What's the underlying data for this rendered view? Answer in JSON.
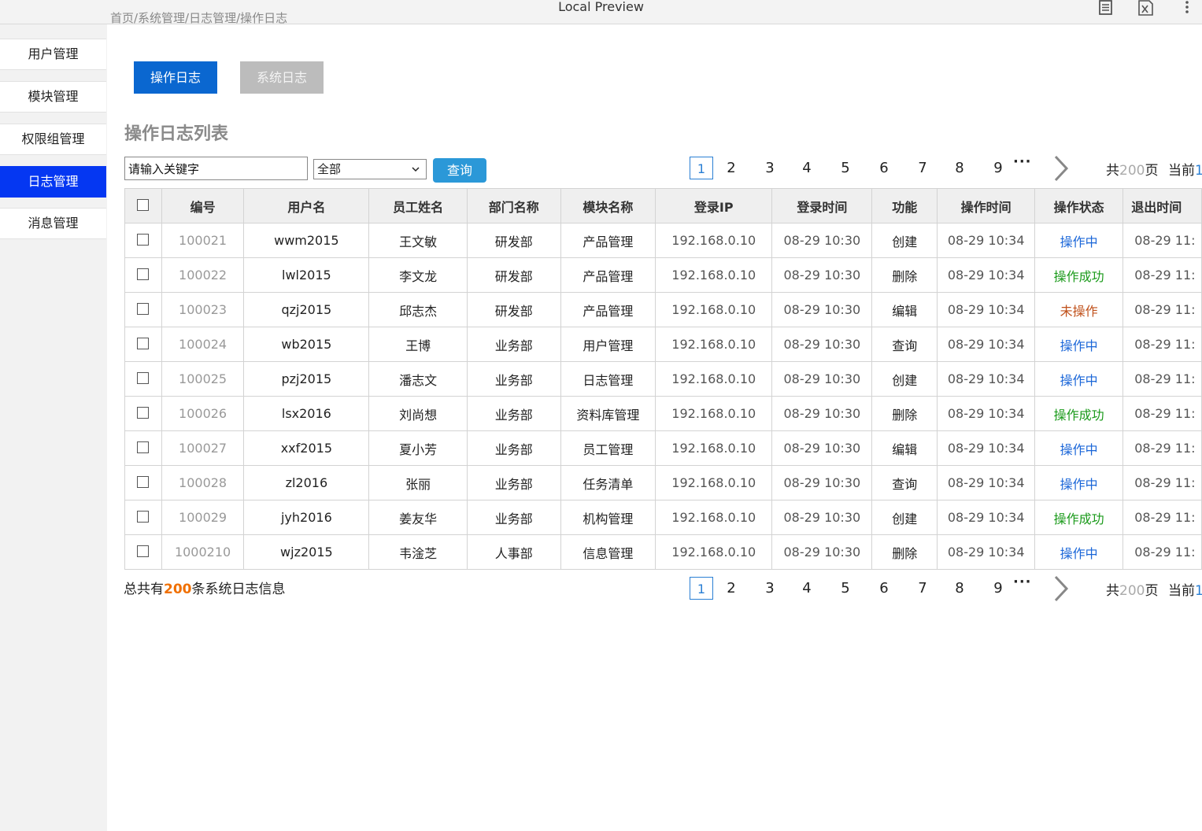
{
  "window": {
    "title": "Local Preview",
    "icons": [
      "document-icon",
      "formula-icon",
      "more-vert-icon"
    ]
  },
  "breadcrumb": "首页/系统管理/日志管理/操作日志",
  "sidebar": {
    "items": [
      {
        "label": "用户管理",
        "active": false
      },
      {
        "label": "模块管理",
        "active": false
      },
      {
        "label": "权限组管理",
        "active": false
      },
      {
        "label": "日志管理",
        "active": true
      },
      {
        "label": "消息管理",
        "active": false
      }
    ]
  },
  "tabs": {
    "operation": "操作日志",
    "system": "系统日志"
  },
  "section_title": "操作日志列表",
  "search": {
    "keyword_value": "请输入关键字",
    "dept_selected": "全部",
    "query_label": "查询"
  },
  "pagination": {
    "pages": [
      "1",
      "2",
      "3",
      "4",
      "5",
      "6",
      "7",
      "8",
      "9"
    ],
    "current": "1",
    "dots": "···",
    "total_prefix": "共",
    "total_pages": "200",
    "total_suffix": "页",
    "current_prefix": "当前",
    "current_value": "1"
  },
  "table": {
    "headers": [
      "编号",
      "用户名",
      "员工姓名",
      "部门名称",
      "模块名称",
      "登录IP",
      "登录时间",
      "功能",
      "操作时间",
      "操作状态",
      "退出时间"
    ],
    "rows": [
      {
        "id": "100021",
        "user": "wwm2015",
        "name": "王文敏",
        "dept": "研发部",
        "module": "产品管理",
        "ip": "192.168.0.10",
        "login": "08-29 10:30",
        "func": "创建",
        "op_time": "08-29 10:34",
        "status": "操作中",
        "status_color": "#1a66d8",
        "logout": "08-29 11:"
      },
      {
        "id": "100022",
        "user": "lwl2015",
        "name": "李文龙",
        "dept": "研发部",
        "module": "产品管理",
        "ip": "192.168.0.10",
        "login": "08-29 10:30",
        "func": "删除",
        "op_time": "08-29 10:34",
        "status": "操作成功",
        "status_color": "#1a9a1a",
        "logout": "08-29 11:"
      },
      {
        "id": "100023",
        "user": "qzj2015",
        "name": "邱志杰",
        "dept": "研发部",
        "module": "产品管理",
        "ip": "192.168.0.10",
        "login": "08-29 10:30",
        "func": "编辑",
        "op_time": "08-29 10:34",
        "status": "未操作",
        "status_color": "#c0501a",
        "logout": "08-29 11:"
      },
      {
        "id": "100024",
        "user": "wb2015",
        "name": "王博",
        "dept": "业务部",
        "module": "用户管理",
        "ip": "192.168.0.10",
        "login": "08-29 10:30",
        "func": "查询",
        "op_time": "08-29 10:34",
        "status": "操作中",
        "status_color": "#1a66d8",
        "logout": "08-29 11:"
      },
      {
        "id": "100025",
        "user": "pzj2015",
        "name": "潘志文",
        "dept": "业务部",
        "module": "日志管理",
        "ip": "192.168.0.10",
        "login": "08-29 10:30",
        "func": "创建",
        "op_time": "08-29 10:34",
        "status": "操作中",
        "status_color": "#1a66d8",
        "logout": "08-29 11:"
      },
      {
        "id": "100026",
        "user": "lsx2016",
        "name": "刘尚想",
        "dept": "业务部",
        "module": "资料库管理",
        "ip": "192.168.0.10",
        "login": "08-29 10:30",
        "func": "删除",
        "op_time": "08-29 10:34",
        "status": "操作成功",
        "status_color": "#1a9a1a",
        "logout": "08-29 11:"
      },
      {
        "id": "100027",
        "user": "xxf2015",
        "name": "夏小芳",
        "dept": "业务部",
        "module": "员工管理",
        "ip": "192.168.0.10",
        "login": "08-29 10:30",
        "func": "编辑",
        "op_time": "08-29 10:34",
        "status": "操作中",
        "status_color": "#1a66d8",
        "logout": "08-29 11:"
      },
      {
        "id": "100028",
        "user": "zl2016",
        "name": "张丽",
        "dept": "业务部",
        "module": "任务清单",
        "ip": "192.168.0.10",
        "login": "08-29 10:30",
        "func": "查询",
        "op_time": "08-29 10:34",
        "status": "操作中",
        "status_color": "#1a66d8",
        "logout": "08-29 11:"
      },
      {
        "id": "100029",
        "user": "jyh2016",
        "name": "姜友华",
        "dept": "业务部",
        "module": "机构管理",
        "ip": "192.168.0.10",
        "login": "08-29 10:30",
        "func": "创建",
        "op_time": "08-29 10:34",
        "status": "操作成功",
        "status_color": "#1a9a1a",
        "logout": "08-29 11:"
      },
      {
        "id": "1000210",
        "user": "wjz2015",
        "name": "韦淦芝",
        "dept": "人事部",
        "module": "信息管理",
        "ip": "192.168.0.10",
        "login": "08-29 10:30",
        "func": "删除",
        "op_time": "08-29 10:34",
        "status": "操作中",
        "status_color": "#1a66d8",
        "logout": "08-29 11:"
      }
    ]
  },
  "footer": {
    "total_prefix": "总共有",
    "total_count": "200",
    "total_suffix": "条系统日志信息"
  }
}
